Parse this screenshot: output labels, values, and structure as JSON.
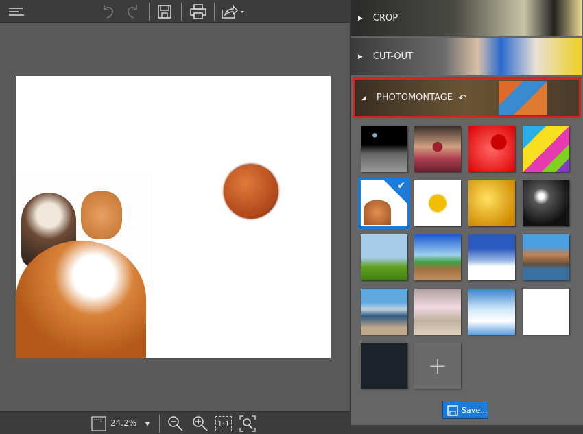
{
  "toolbar": {
    "icons": [
      "menu-icon",
      "undo-icon",
      "redo-icon",
      "save-icon",
      "print-icon",
      "share-icon"
    ]
  },
  "zoom": {
    "value": "24.2%",
    "one_to_one": "1:1"
  },
  "panel": {
    "sections": [
      {
        "label": "CROP",
        "expanded": false
      },
      {
        "label": "CUT-OUT",
        "expanded": false
      },
      {
        "label": "PHOTOMONTAGE",
        "expanded": true
      }
    ],
    "save_label": "Save...",
    "selected_index": 4,
    "accent": "#1c7ad8",
    "highlight": "#e02020"
  }
}
